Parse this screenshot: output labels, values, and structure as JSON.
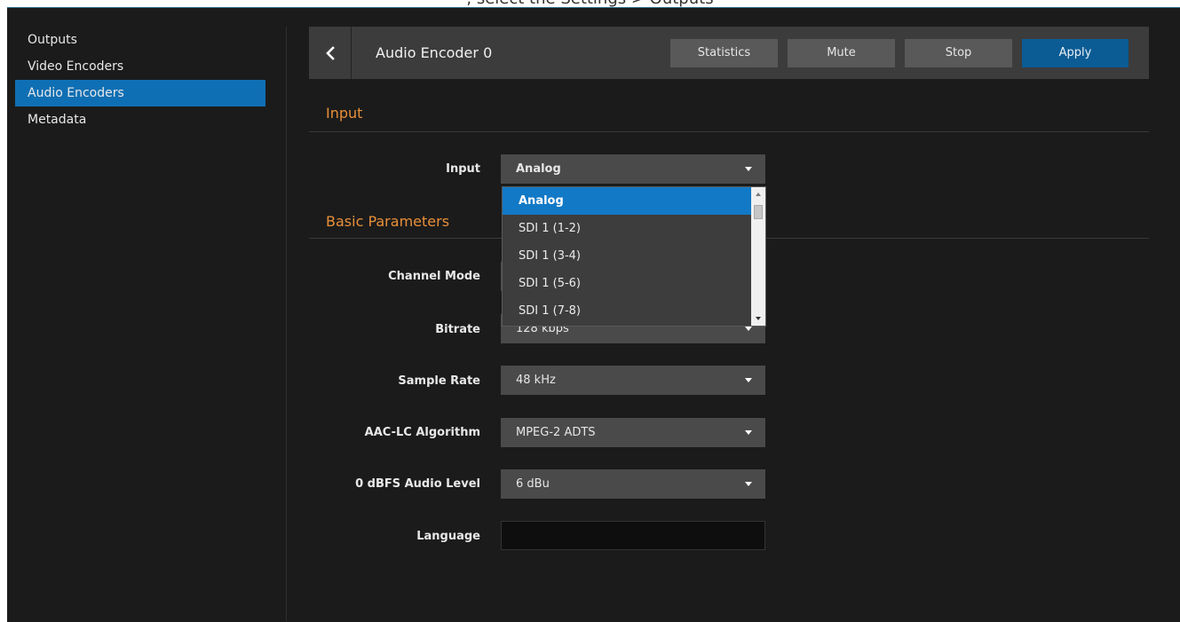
{
  "top_caption": ", select the Settings > Outputs",
  "sidebar": {
    "items": [
      {
        "label": "Outputs"
      },
      {
        "label": "Video Encoders"
      },
      {
        "label": "Audio Encoders"
      },
      {
        "label": "Metadata"
      }
    ],
    "active_index": 2
  },
  "header": {
    "title": "Audio Encoder 0",
    "buttons": {
      "statistics": "Statistics",
      "mute": "Mute",
      "stop": "Stop",
      "apply": "Apply"
    }
  },
  "sections": {
    "input": "Input",
    "basic": "Basic Parameters"
  },
  "fields": {
    "input": {
      "label": "Input",
      "value": "Analog"
    },
    "channel_mode": {
      "label": "Channel Mode",
      "value": ""
    },
    "bitrate": {
      "label": "Bitrate",
      "value": "128 kbps"
    },
    "sample_rate": {
      "label": "Sample Rate",
      "value": "48 kHz"
    },
    "aac_algorithm": {
      "label": "AAC-LC Algorithm",
      "value": "MPEG-2 ADTS"
    },
    "audio_level": {
      "label": "0 dBFS Audio Level",
      "value": "6 dBu"
    },
    "language": {
      "label": "Language",
      "value": ""
    }
  },
  "input_dropdown": {
    "options": [
      "Analog",
      "SDI 1 (1-2)",
      "SDI 1 (3-4)",
      "SDI 1 (5-6)",
      "SDI 1 (7-8)"
    ],
    "selected": "Analog"
  },
  "icons": {
    "back": "chevron-left-icon",
    "caret": "caret-down-icon"
  },
  "colors": {
    "background": "#1b1b1b",
    "accent_blue": "#0f6fb4",
    "section_orange": "#e8903a",
    "apply_button": "#0b5c94"
  }
}
